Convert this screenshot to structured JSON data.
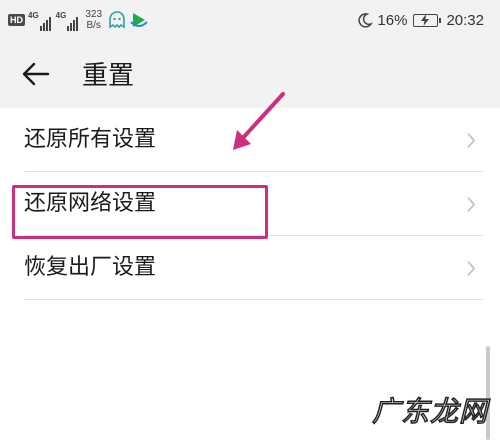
{
  "status_bar": {
    "hd": "HD",
    "signal_1": "4G",
    "signal_2": "4G",
    "speed_value": "323",
    "speed_unit": "B/s",
    "app_icons": [
      "ghost-app-icon",
      "video-app-icon"
    ],
    "dnd_icon": "moon-icon",
    "battery_percent": "16%",
    "battery_icon": "battery-charging-icon",
    "time": "20:32"
  },
  "header": {
    "back_icon": "back-arrow-icon",
    "title": "重置"
  },
  "list": {
    "items": [
      {
        "label": "还原所有设置",
        "icon": "chevron-right-icon"
      },
      {
        "label": "还原网络设置",
        "icon": "chevron-right-icon"
      },
      {
        "label": "恢复出厂设置",
        "icon": "chevron-right-icon"
      }
    ]
  },
  "annotation": {
    "color": "#cc2f7b",
    "highlighted_item": "还原网络设置"
  },
  "watermark": {
    "text": "广东龙网"
  }
}
